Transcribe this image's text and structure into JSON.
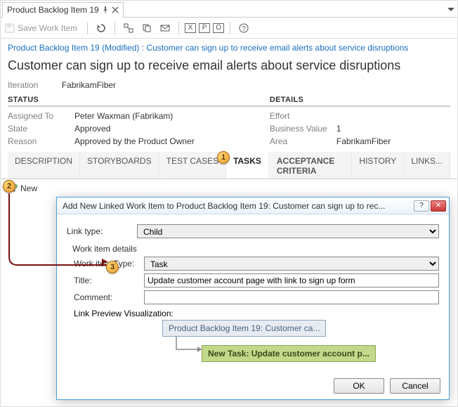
{
  "window": {
    "tab_title": "Product Backlog Item 19"
  },
  "toolbar": {
    "save": "Save Work Item",
    "boxed": [
      "X",
      "P",
      "O"
    ]
  },
  "breadcrumb": "Product Backlog Item 19 (Modified) : Customer can sign up to receive email alerts about service disruptions",
  "title": "Customer can sign up to receive email alerts about service disruptions",
  "iteration": {
    "label": "Iteration",
    "value": "FabrikamFiber"
  },
  "status": {
    "heading": "STATUS",
    "assigned_to": {
      "label": "Assigned To",
      "value": "Peter Waxman (Fabrikam)"
    },
    "state": {
      "label": "State",
      "value": "Approved"
    },
    "reason": {
      "label": "Reason",
      "value": "Approved by the Product Owner"
    }
  },
  "details": {
    "heading": "DETAILS",
    "effort": {
      "label": "Effort",
      "value": ""
    },
    "business_value": {
      "label": "Business Value",
      "value": "1"
    },
    "area": {
      "label": "Area",
      "value": "FabrikamFiber"
    }
  },
  "tabs_left": [
    "DESCRIPTION",
    "STORYBOARDS",
    "TEST CASES",
    "TASKS"
  ],
  "tabs_right": [
    "ACCEPTANCE CRITERIA",
    "HISTORY",
    "LINKS..."
  ],
  "below": {
    "new_label": "New"
  },
  "callouts": {
    "c1": "1",
    "c2": "2",
    "c3": "3"
  },
  "dialog": {
    "title": "Add New Linked Work Item to Product Backlog Item 19: Customer can sign up to rec...",
    "link_type": {
      "label": "Link type:",
      "value": "Child"
    },
    "group": "Work item details",
    "work_item_type": {
      "label": "Work item Type:",
      "value": "Task"
    },
    "title_field": {
      "label": "Title:",
      "value": "Update customer account page with link to sign up form"
    },
    "comment": {
      "label": "Comment:",
      "value": ""
    },
    "preview_label": "Link Preview Visualization:",
    "preview_parent": "Product Backlog Item 19: Customer ca...",
    "preview_child": "New Task: Update customer account p...",
    "ok": "OK",
    "cancel": "Cancel",
    "help": "?",
    "close": "✕"
  }
}
